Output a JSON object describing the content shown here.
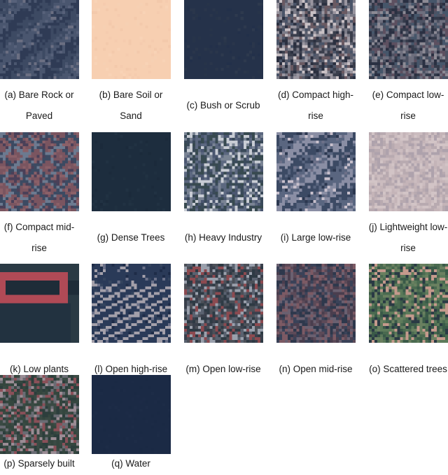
{
  "figure": {
    "panels": [
      {
        "id": "a",
        "label": "(a) Bare Rock or",
        "label2": "Paved",
        "class": "Bare Rock or Paved",
        "palette": [
          "#3d4a63",
          "#4a566f",
          "#2f3b55",
          "#57617a",
          "#6b6f82",
          "#33405a"
        ],
        "style": "diag"
      },
      {
        "id": "b",
        "label": "(b) Bare Soil or",
        "label2": "Sand",
        "class": "Bare Soil or Sand",
        "palette": [
          "#f7cfb1",
          "#f5cbae",
          "#f8d3b6",
          "#f3c9ab",
          "#f6d0b3"
        ],
        "style": "smooth"
      },
      {
        "id": "c",
        "label": "(c) Bush or Scrub",
        "label2": "",
        "class": "Bush or Scrub",
        "palette": [
          "#25324a",
          "#273449",
          "#22304a",
          "#2a364b",
          "#2e3a4e"
        ],
        "style": "smooth"
      },
      {
        "id": "d",
        "label": "(d) Compact high-",
        "label2": "rise",
        "class": "Compact high-rise",
        "palette": [
          "#3a3e4c",
          "#5a5d6c",
          "#7c7c88",
          "#2b3040",
          "#9a96a0",
          "#6a5a62",
          "#4a5468",
          "#c8c0c4"
        ],
        "style": "noise"
      },
      {
        "id": "e",
        "label": "(e) Compact low-",
        "label2": "rise",
        "class": "Compact low-rise",
        "palette": [
          "#343a4a",
          "#4d5263",
          "#6e6f7e",
          "#2a3042",
          "#8c8a94",
          "#5d5060",
          "#46566a"
        ],
        "style": "noise"
      },
      {
        "id": "f",
        "label": "(f) Compact mid-",
        "label2": "rise",
        "class": "Compact mid-rise",
        "palette": [
          "#5b4a5e",
          "#7a5560",
          "#3c4a62",
          "#6c7a90",
          "#4a4058",
          "#8a6068"
        ],
        "style": "grid"
      },
      {
        "id": "g",
        "label": "(g) Dense Trees",
        "label2": "",
        "class": "Dense Trees",
        "palette": [
          "#1d2d3e",
          "#1f3040",
          "#1b2a3b",
          "#213243"
        ],
        "style": "smooth"
      },
      {
        "id": "h",
        "label": "(h) Heavy Industry",
        "label2": "",
        "class": "Heavy Industry",
        "palette": [
          "#4a5670",
          "#5c6880",
          "#3a4a5a",
          "#7a8494",
          "#c8ccd4",
          "#384a50"
        ],
        "style": "noise"
      },
      {
        "id": "i",
        "label": "(i) Large low-rise",
        "label2": "",
        "class": "Large low-rise",
        "palette": [
          "#3c4a64",
          "#5a6680",
          "#8a8ea4",
          "#2c3850",
          "#c8c0cc",
          "#6c7088"
        ],
        "style": "diag"
      },
      {
        "id": "j",
        "label": "(j) Lightweight low-",
        "label2": "rise",
        "class": "Lightweight low-rise",
        "palette": [
          "#c4b4b8",
          "#b8aab0",
          "#cbbcbf",
          "#aea2ac",
          "#d2c4c6"
        ],
        "style": "noise"
      },
      {
        "id": "k",
        "label": "(k) Low plants",
        "label2": "",
        "class": "Low plants",
        "palette": [
          "#1e2c38",
          "#223240",
          "#b04a56",
          "#2a3a44"
        ],
        "style": "plants"
      },
      {
        "id": "l",
        "label": "(l) Open high-rise",
        "label2": "",
        "class": "Open high-rise",
        "palette": [
          "#2a3a58",
          "#34445e",
          "#a4a0aa",
          "#6a7088",
          "#1e2c48"
        ],
        "style": "stripes"
      },
      {
        "id": "m",
        "label": "(m) Open low-rise",
        "label2": "",
        "class": "Open low-rise",
        "palette": [
          "#3a404c",
          "#2e3a44",
          "#5a6270",
          "#9aa0ac",
          "#4c5058",
          "#8c4a50"
        ],
        "style": "noise"
      },
      {
        "id": "n",
        "label": "(n) Open mid-rise",
        "label2": "",
        "class": "Open mid-rise",
        "palette": [
          "#4a3e4e",
          "#5c4a58",
          "#3a4258",
          "#6a6070",
          "#7c5a64",
          "#2e384c"
        ],
        "style": "noise"
      },
      {
        "id": "o",
        "label": "(o) Scattered trees",
        "label2": "",
        "class": "Scattered trees",
        "palette": [
          "#4a6a50",
          "#5c7a5a",
          "#2a3a44",
          "#3a5a48",
          "#c49a8c",
          "#6a8060"
        ],
        "style": "noise"
      },
      {
        "id": "p",
        "label": "(p) Sparsely built",
        "label2": "",
        "class": "Sparsely built",
        "palette": [
          "#2c3e3c",
          "#34463e",
          "#3a4a44",
          "#6a6c74",
          "#9a8c94",
          "#8a5058"
        ],
        "style": "noise"
      },
      {
        "id": "q",
        "label": "(q) Water",
        "label2": "",
        "class": "Water",
        "palette": [
          "#1b2a45",
          "#1c2b46",
          "#1a2944",
          "#1d2c47"
        ],
        "style": "smooth"
      }
    ]
  }
}
